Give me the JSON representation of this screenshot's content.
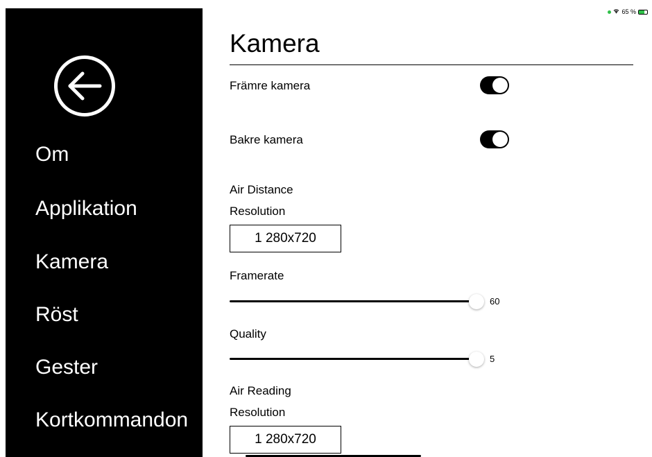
{
  "status": {
    "percent": "65 %"
  },
  "sidebar": {
    "back_icon": "arrow-left-circle-icon",
    "items": [
      {
        "label": "Om"
      },
      {
        "label": "Applikation"
      },
      {
        "label": "Kamera"
      },
      {
        "label": "Röst"
      },
      {
        "label": "Gester"
      },
      {
        "label": "Kortkommandon"
      }
    ]
  },
  "main": {
    "title": "Kamera",
    "front_camera": {
      "label": "Främre kamera",
      "on": true
    },
    "back_camera": {
      "label": "Bakre kamera",
      "on": true
    },
    "air_distance": {
      "heading": "Air Distance",
      "resolution_label": "Resolution",
      "resolution_value": "1 280x720",
      "framerate_label": "Framerate",
      "framerate_value": "60",
      "quality_label": "Quality",
      "quality_value": "5"
    },
    "air_reading": {
      "heading": "Air Reading",
      "resolution_label": "Resolution",
      "resolution_value": "1 280x720"
    }
  }
}
